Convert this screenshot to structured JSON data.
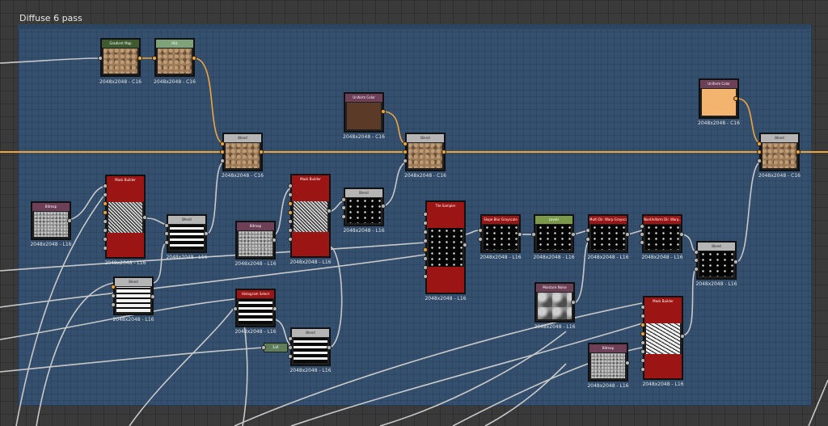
{
  "frame": {
    "title": "Diffuse 6 pass"
  },
  "nodes": {
    "gradient_map": {
      "title": "Gradient Map",
      "res": "2048x2048 - C16"
    },
    "hsl": {
      "title": "HSL",
      "res": "2048x2048 - C16"
    },
    "uniform_color_1": {
      "title": "Uniform Color",
      "res": "2048x2048 - C16"
    },
    "uniform_color_2": {
      "title": "Uniform Color",
      "res": "2048x2048 - C16"
    },
    "blend_1": {
      "title": "Blend",
      "res": "2048x2048 - C16"
    },
    "blend_2": {
      "title": "Blend",
      "res": "2048x2048 - C16"
    },
    "blend_3": {
      "title": "Blend",
      "res": "2048x2048 - C16"
    },
    "bitmap_1": {
      "title": "Bitmap",
      "res": "2048x2048 - L16"
    },
    "mask_builder_1": {
      "title": "Mask Builder",
      "res": "2048x2048 - L16"
    },
    "blend_4": {
      "title": "Blend",
      "res": "2048x2048 - L16"
    },
    "bitmap_2": {
      "title": "Bitmap",
      "res": "2048x2048 - L16"
    },
    "mask_builder_2": {
      "title": "Mask Builder",
      "res": "2048x2048 - L16"
    },
    "blend_5": {
      "title": "Blend",
      "res": "2048x2048 - L16"
    },
    "tile_sampler": {
      "title": "Tile Sampler",
      "res": "2048x2048 - L16"
    },
    "slope_blur": {
      "title": "Slope Blur Grayscale",
      "res": "2048x2048 - L16"
    },
    "levels": {
      "title": "Levels",
      "res": "2048x2048 - L16"
    },
    "multi_dir_warp": {
      "title": "Multi Dir. Warp Grayscale",
      "res": "2048x2048 - L16"
    },
    "nonuniform_dir_warp": {
      "title": "NonUniform Dir. Warp...",
      "res": "2048x2048 - L16"
    },
    "blend_6": {
      "title": "Blend",
      "res": "2048x2048 - L16"
    },
    "blend_7": {
      "title": "Blend",
      "res": "2048x2048 - L16"
    },
    "histogram_select": {
      "title": "Histogram Select",
      "res": "2048x2048 - L16"
    },
    "blend_8": {
      "title": "Blend",
      "res": "2048x2048 - L16"
    },
    "moisture_noise": {
      "title": "Moisture Noise",
      "res": "2048x2048 - L16"
    },
    "mask_builder_3": {
      "title": "Mask Builder",
      "res": "2048x2048 - L16"
    },
    "bitmap_3": {
      "title": "Bitmap",
      "res": "2048x2048 - L16"
    },
    "lvl_small": {
      "title": "Lvl"
    }
  },
  "colors": {
    "wire_gray": "#c8c8c8",
    "wire_orange": "#f0a43a",
    "frame_bg": "#34506e",
    "brown_swatch": "#5b3b28",
    "peach_swatch": "#f2b46e"
  }
}
